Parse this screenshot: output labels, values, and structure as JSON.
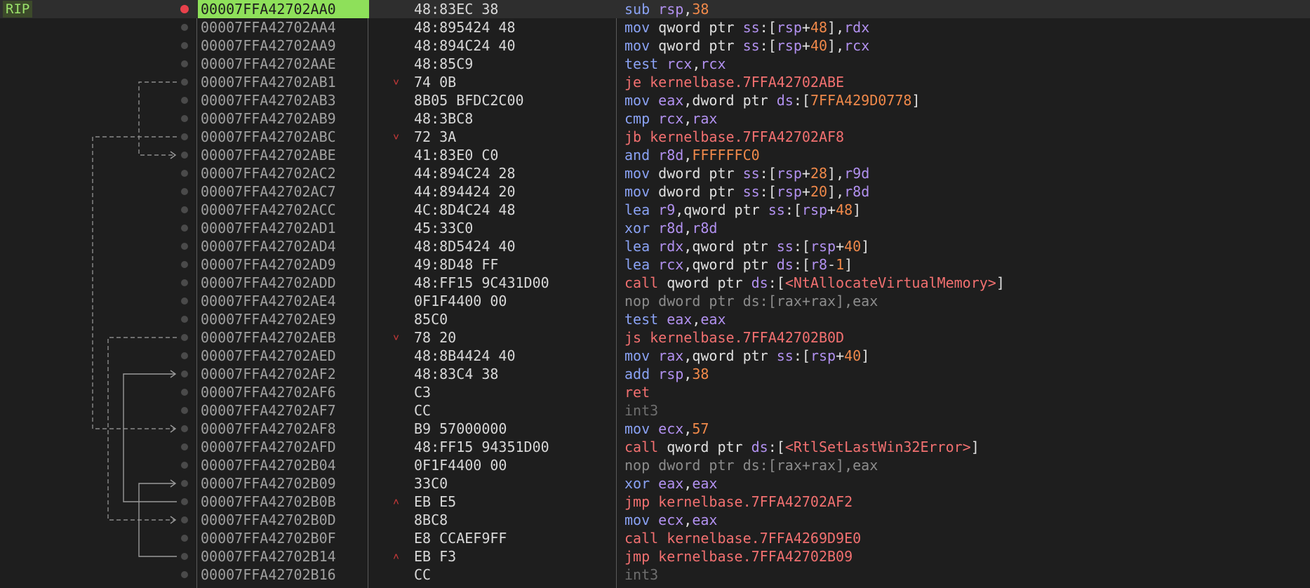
{
  "rip_label": "RIP",
  "rows": [
    {
      "address": "00007FFA42702AA0",
      "bytes": "48:83EC 38",
      "mnemonic": "sub",
      "kind": "normal",
      "bp": true,
      "current": true,
      "ops": [
        [
          "sub",
          "normal"
        ],
        [
          " ",
          "txt"
        ],
        [
          "rsp",
          "reg"
        ],
        [
          ",",
          "txt"
        ],
        [
          "38",
          "num"
        ]
      ]
    },
    {
      "address": "00007FFA42702AA4",
      "bytes": "48:895424 48",
      "kind": "normal",
      "ops": [
        [
          "mov",
          "normal"
        ],
        [
          " qword ptr ",
          "size"
        ],
        [
          "ss",
          "seg"
        ],
        [
          ":[",
          "br"
        ],
        [
          "rsp",
          "reg"
        ],
        [
          "+",
          "txt"
        ],
        [
          "48",
          "num"
        ],
        [
          "],",
          "br"
        ],
        [
          "rdx",
          "reg"
        ]
      ]
    },
    {
      "address": "00007FFA42702AA9",
      "bytes": "48:894C24 40",
      "kind": "normal",
      "ops": [
        [
          "mov",
          "normal"
        ],
        [
          " qword ptr ",
          "size"
        ],
        [
          "ss",
          "seg"
        ],
        [
          ":[",
          "br"
        ],
        [
          "rsp",
          "reg"
        ],
        [
          "+",
          "txt"
        ],
        [
          "40",
          "num"
        ],
        [
          "],",
          "br"
        ],
        [
          "rcx",
          "reg"
        ]
      ]
    },
    {
      "address": "00007FFA42702AAE",
      "bytes": "48:85C9",
      "kind": "normal",
      "ops": [
        [
          "test",
          "normal"
        ],
        [
          " ",
          "txt"
        ],
        [
          "rcx",
          "reg"
        ],
        [
          ",",
          "txt"
        ],
        [
          "rcx",
          "reg"
        ]
      ]
    },
    {
      "address": "00007FFA42702AB1",
      "bytes": "74 0B",
      "kind": "jump",
      "arrow": "v",
      "ops": [
        [
          "je",
          "jump"
        ],
        [
          " kernelbase.7FFA42702ABE",
          "sym"
        ]
      ]
    },
    {
      "address": "00007FFA42702AB3",
      "bytes": "8B05 BFDC2C00",
      "kind": "normal",
      "ops": [
        [
          "mov",
          "normal"
        ],
        [
          " ",
          "txt"
        ],
        [
          "eax",
          "reg"
        ],
        [
          ",dword ptr ",
          "size"
        ],
        [
          "ds",
          "seg"
        ],
        [
          ":[",
          "br"
        ],
        [
          "7FFA429D0778",
          "num"
        ],
        [
          "]",
          "br"
        ]
      ]
    },
    {
      "address": "00007FFA42702AB9",
      "bytes": "48:3BC8",
      "kind": "normal",
      "ops": [
        [
          "cmp",
          "normal"
        ],
        [
          " ",
          "txt"
        ],
        [
          "rcx",
          "reg"
        ],
        [
          ",",
          "txt"
        ],
        [
          "rax",
          "reg"
        ]
      ]
    },
    {
      "address": "00007FFA42702ABC",
      "bytes": "72 3A",
      "kind": "jump",
      "arrow": "v",
      "ops": [
        [
          "jb",
          "jump"
        ],
        [
          " kernelbase.7FFA42702AF8",
          "sym"
        ]
      ]
    },
    {
      "address": "00007FFA42702ABE",
      "bytes": "41:83E0 C0",
      "kind": "normal",
      "ops": [
        [
          "and",
          "normal"
        ],
        [
          " ",
          "txt"
        ],
        [
          "r8d",
          "reg"
        ],
        [
          ",",
          "txt"
        ],
        [
          "FFFFFFC0",
          "num"
        ]
      ]
    },
    {
      "address": "00007FFA42702AC2",
      "bytes": "44:894C24 28",
      "kind": "normal",
      "ops": [
        [
          "mov",
          "normal"
        ],
        [
          " dword ptr ",
          "size"
        ],
        [
          "ss",
          "seg"
        ],
        [
          ":[",
          "br"
        ],
        [
          "rsp",
          "reg"
        ],
        [
          "+",
          "txt"
        ],
        [
          "28",
          "num"
        ],
        [
          "],",
          "br"
        ],
        [
          "r9d",
          "reg"
        ]
      ]
    },
    {
      "address": "00007FFA42702AC7",
      "bytes": "44:894424 20",
      "kind": "normal",
      "ops": [
        [
          "mov",
          "normal"
        ],
        [
          " dword ptr ",
          "size"
        ],
        [
          "ss",
          "seg"
        ],
        [
          ":[",
          "br"
        ],
        [
          "rsp",
          "reg"
        ],
        [
          "+",
          "txt"
        ],
        [
          "20",
          "num"
        ],
        [
          "],",
          "br"
        ],
        [
          "r8d",
          "reg"
        ]
      ]
    },
    {
      "address": "00007FFA42702ACC",
      "bytes": "4C:8D4C24 48",
      "kind": "normal",
      "ops": [
        [
          "lea",
          "normal"
        ],
        [
          " ",
          "txt"
        ],
        [
          "r9",
          "reg"
        ],
        [
          ",qword ptr ",
          "size"
        ],
        [
          "ss",
          "seg"
        ],
        [
          ":[",
          "br"
        ],
        [
          "rsp",
          "reg"
        ],
        [
          "+",
          "txt"
        ],
        [
          "48",
          "num"
        ],
        [
          "]",
          "br"
        ]
      ]
    },
    {
      "address": "00007FFA42702AD1",
      "bytes": "45:33C0",
      "kind": "normal",
      "ops": [
        [
          "xor",
          "normal"
        ],
        [
          " ",
          "txt"
        ],
        [
          "r8d",
          "reg"
        ],
        [
          ",",
          "txt"
        ],
        [
          "r8d",
          "reg"
        ]
      ]
    },
    {
      "address": "00007FFA42702AD4",
      "bytes": "48:8D5424 40",
      "kind": "normal",
      "ops": [
        [
          "lea",
          "normal"
        ],
        [
          " ",
          "txt"
        ],
        [
          "rdx",
          "reg"
        ],
        [
          ",qword ptr ",
          "size"
        ],
        [
          "ss",
          "seg"
        ],
        [
          ":[",
          "br"
        ],
        [
          "rsp",
          "reg"
        ],
        [
          "+",
          "txt"
        ],
        [
          "40",
          "num"
        ],
        [
          "]",
          "br"
        ]
      ]
    },
    {
      "address": "00007FFA42702AD9",
      "bytes": "49:8D48 FF",
      "kind": "normal",
      "ops": [
        [
          "lea",
          "normal"
        ],
        [
          " ",
          "txt"
        ],
        [
          "rcx",
          "reg"
        ],
        [
          ",qword ptr ",
          "size"
        ],
        [
          "ds",
          "seg"
        ],
        [
          ":[",
          "br"
        ],
        [
          "r8",
          "reg"
        ],
        [
          "-",
          "txt"
        ],
        [
          "1",
          "num"
        ],
        [
          "]",
          "br"
        ]
      ]
    },
    {
      "address": "00007FFA42702ADD",
      "bytes": "48:FF15 9C431D00",
      "kind": "call",
      "ops": [
        [
          "call",
          "call"
        ],
        [
          " qword ptr ",
          "size"
        ],
        [
          "ds",
          "seg"
        ],
        [
          ":[",
          "br"
        ],
        [
          "<NtAllocateVirtualMemory>",
          "sym"
        ],
        [
          "]",
          "br"
        ]
      ]
    },
    {
      "address": "00007FFA42702AE4",
      "bytes": "0F1F4400 00",
      "kind": "nop",
      "ops": [
        [
          "nop",
          "nop"
        ],
        [
          " dword ptr ds:[rax+rax],eax",
          "nop"
        ]
      ]
    },
    {
      "address": "00007FFA42702AE9",
      "bytes": "85C0",
      "kind": "normal",
      "ops": [
        [
          "test",
          "normal"
        ],
        [
          " ",
          "txt"
        ],
        [
          "eax",
          "reg"
        ],
        [
          ",",
          "txt"
        ],
        [
          "eax",
          "reg"
        ]
      ]
    },
    {
      "address": "00007FFA42702AEB",
      "bytes": "78 20",
      "kind": "jump",
      "arrow": "v",
      "ops": [
        [
          "js",
          "jump"
        ],
        [
          " kernelbase.7FFA42702B0D",
          "sym"
        ]
      ]
    },
    {
      "address": "00007FFA42702AED",
      "bytes": "48:8B4424 40",
      "kind": "normal",
      "ops": [
        [
          "mov",
          "normal"
        ],
        [
          " ",
          "txt"
        ],
        [
          "rax",
          "reg"
        ],
        [
          ",qword ptr ",
          "size"
        ],
        [
          "ss",
          "seg"
        ],
        [
          ":[",
          "br"
        ],
        [
          "rsp",
          "reg"
        ],
        [
          "+",
          "txt"
        ],
        [
          "40",
          "num"
        ],
        [
          "]",
          "br"
        ]
      ]
    },
    {
      "address": "00007FFA42702AF2",
      "bytes": "48:83C4 38",
      "kind": "normal",
      "ops": [
        [
          "add",
          "normal"
        ],
        [
          " ",
          "txt"
        ],
        [
          "rsp",
          "reg"
        ],
        [
          ",",
          "txt"
        ],
        [
          "38",
          "num"
        ]
      ]
    },
    {
      "address": "00007FFA42702AF6",
      "bytes": "C3",
      "kind": "ret",
      "ops": [
        [
          "ret",
          "ret"
        ]
      ]
    },
    {
      "address": "00007FFA42702AF7",
      "bytes": "CC",
      "kind": "int",
      "ops": [
        [
          "int3",
          "int"
        ]
      ]
    },
    {
      "address": "00007FFA42702AF8",
      "bytes": "B9 57000000",
      "kind": "normal",
      "ops": [
        [
          "mov",
          "normal"
        ],
        [
          " ",
          "txt"
        ],
        [
          "ecx",
          "reg"
        ],
        [
          ",",
          "txt"
        ],
        [
          "57",
          "num"
        ]
      ]
    },
    {
      "address": "00007FFA42702AFD",
      "bytes": "48:FF15 94351D00",
      "kind": "call",
      "ops": [
        [
          "call",
          "call"
        ],
        [
          " qword ptr ",
          "size"
        ],
        [
          "ds",
          "seg"
        ],
        [
          ":[",
          "br"
        ],
        [
          "<RtlSetLastWin32Error>",
          "sym"
        ],
        [
          "]",
          "br"
        ]
      ]
    },
    {
      "address": "00007FFA42702B04",
      "bytes": "0F1F4400 00",
      "kind": "nop",
      "ops": [
        [
          "nop",
          "nop"
        ],
        [
          " dword ptr ds:[rax+rax],eax",
          "nop"
        ]
      ]
    },
    {
      "address": "00007FFA42702B09",
      "bytes": "33C0",
      "kind": "normal",
      "ops": [
        [
          "xor",
          "normal"
        ],
        [
          " ",
          "txt"
        ],
        [
          "eax",
          "reg"
        ],
        [
          ",",
          "txt"
        ],
        [
          "eax",
          "reg"
        ]
      ]
    },
    {
      "address": "00007FFA42702B0B",
      "bytes": "EB E5",
      "kind": "jump",
      "arrow": "^",
      "ops": [
        [
          "jmp",
          "jump"
        ],
        [
          " kernelbase.7FFA42702AF2",
          "sym"
        ]
      ]
    },
    {
      "address": "00007FFA42702B0D",
      "bytes": "8BC8",
      "kind": "normal",
      "ops": [
        [
          "mov",
          "normal"
        ],
        [
          " ",
          "txt"
        ],
        [
          "ecx",
          "reg"
        ],
        [
          ",",
          "txt"
        ],
        [
          "eax",
          "reg"
        ]
      ]
    },
    {
      "address": "00007FFA42702B0F",
      "bytes": "E8 CCAEF9FF",
      "kind": "call",
      "ops": [
        [
          "call",
          "call"
        ],
        [
          " kernelbase.7FFA4269D9E0",
          "sym"
        ]
      ]
    },
    {
      "address": "00007FFA42702B14",
      "bytes": "EB F3",
      "kind": "jump",
      "arrow": "^",
      "ops": [
        [
          "jmp",
          "jump"
        ],
        [
          " kernelbase.7FFA42702B09",
          "sym"
        ]
      ]
    },
    {
      "address": "00007FFA42702B16",
      "bytes": "CC",
      "kind": "int",
      "ops": [
        [
          "int3",
          "int"
        ]
      ]
    }
  ],
  "jumps": [
    {
      "from": 4,
      "to": 8,
      "taken": false
    },
    {
      "from": 7,
      "to": 23,
      "taken": false
    },
    {
      "from": 18,
      "to": 28,
      "taken": false
    },
    {
      "from": 27,
      "to": 20,
      "taken": true
    },
    {
      "from": 30,
      "to": 26,
      "taken": true
    }
  ],
  "colors": {
    "background": "#1e1e1e",
    "current_address_bg": "#8ee05a",
    "breakpoint": "#e8414b",
    "mnemonic": "#8aa2f4",
    "jump_mnemonic": "#f27070",
    "register": "#b291f0",
    "number": "#f0894a"
  }
}
